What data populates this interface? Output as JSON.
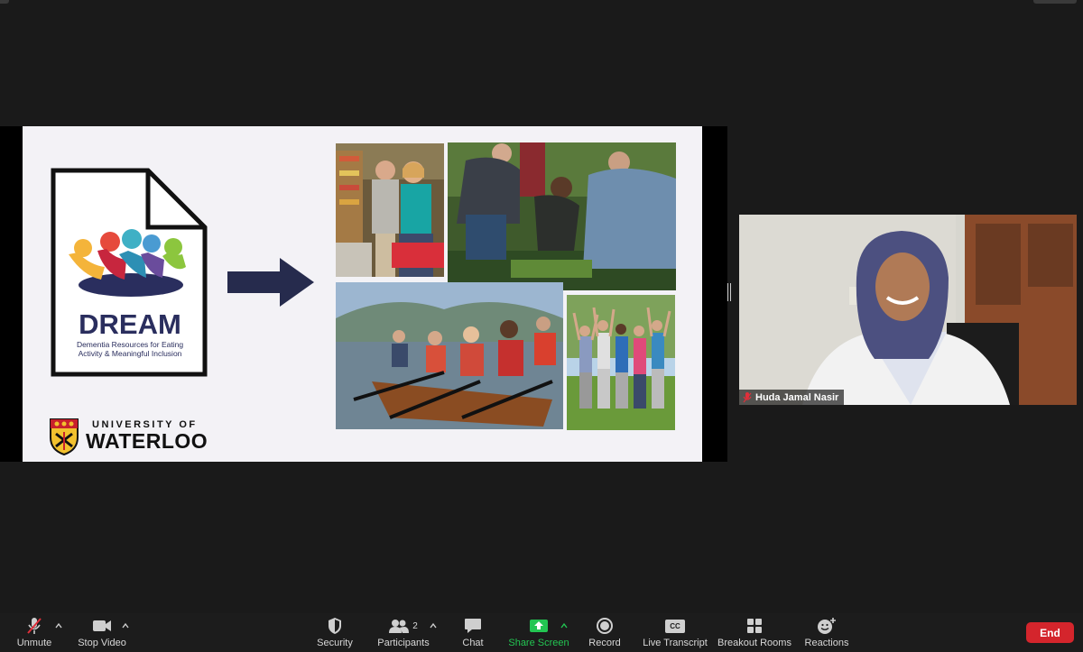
{
  "slide": {
    "logo_title": "DREAM",
    "logo_subtitle_line1": "Dementia Resources for Eating",
    "logo_subtitle_line2": "Activity & Meaningful Inclusion",
    "university_line1": "UNIVERSITY OF",
    "university_line2": "WATERLOO"
  },
  "participant": {
    "name": "Huda Jamal Nasir"
  },
  "toolbar": {
    "unmute": "Unmute",
    "stop_video": "Stop Video",
    "security": "Security",
    "participants": "Participants",
    "participants_count": "2",
    "chat": "Chat",
    "share_screen": "Share Screen",
    "record": "Record",
    "live_transcript": "Live Transcript",
    "cc": "CC",
    "breakout_rooms": "Breakout Rooms",
    "reactions": "Reactions",
    "end": "End"
  },
  "colors": {
    "background": "#1a1a1a",
    "share_green": "#23c552",
    "end_red": "#d4252c",
    "dream_navy": "#2a2e5e"
  }
}
